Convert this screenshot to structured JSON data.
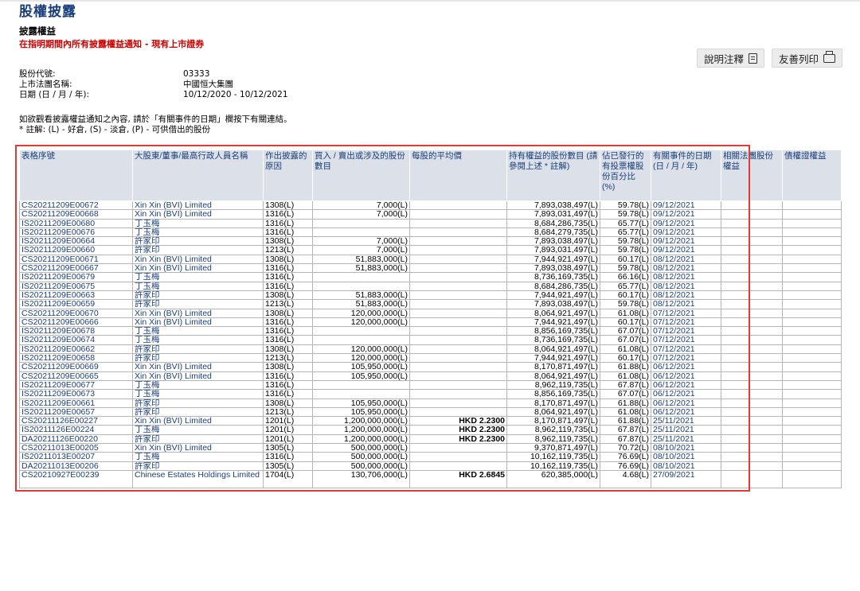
{
  "page_title": "股權披露",
  "section_title": "披露權益",
  "notice": "在指明期間內所有披露權益通知 - 現有上市證券",
  "toolbar": {
    "notes_label": "說明注釋",
    "print_label": "友善列印"
  },
  "meta": [
    {
      "label": "股份代號:",
      "value": "03333"
    },
    {
      "label": "上市法團名稱:",
      "value": "中國恒大集團"
    },
    {
      "label": "日期 (日 / 月 / 年):",
      "value": "10/12/2020 - 10/12/2021"
    }
  ],
  "instructions": [
    "如欲觀看披露權益通知之內容, 請於「有關事件的日期」欄按下有關連結。",
    "* 註解: (L) - 好倉, (S) - 淡倉, (P) - 可供借出的股份"
  ],
  "table": {
    "headers": [
      "表格序號",
      "大股東/董事/最高行政人員名稱",
      "作出披露的原因",
      "買入 / 賣出或涉及的股份數目",
      "每股的平均價",
      "持有權益的股份數目 (請參閱上述 * 註解)",
      "佔已發行的有投票權股份百分比 (%)",
      "有關事件的日期 (日 / 月 / 年)",
      "相關法團股份權益",
      "債權證權益"
    ],
    "rows": [
      [
        "CS20211209E00672",
        "Xin Xin (BVI) Limited",
        "1308(L)",
        "7,000(L)",
        "",
        "7,893,038,497(L)",
        "59.78(L)",
        "09/12/2021"
      ],
      [
        "CS20211209E00668",
        "Xin Xin (BVI) Limited",
        "1316(L)",
        "7,000(L)",
        "",
        "7,893,031,497(L)",
        "59.78(L)",
        "09/12/2021"
      ],
      [
        "IS20211209E00680",
        "丁玉梅",
        "1316(L)",
        "",
        "",
        "8,684,286,735(L)",
        "65.77(L)",
        "09/12/2021"
      ],
      [
        "IS20211209E00676",
        "丁玉梅",
        "1316(L)",
        "",
        "",
        "8,684,279,735(L)",
        "65.77(L)",
        "09/12/2021"
      ],
      [
        "IS20211209E00664",
        "許家印",
        "1308(L)",
        "7,000(L)",
        "",
        "7,893,038,497(L)",
        "59.78(L)",
        "09/12/2021"
      ],
      [
        "IS20211209E00660",
        "許家印",
        "1213(L)",
        "7,000(L)",
        "",
        "7,893,031,497(L)",
        "59.78(L)",
        "09/12/2021"
      ],
      [
        "CS20211209E00671",
        "Xin Xin (BVI) Limited",
        "1308(L)",
        "51,883,000(L)",
        "",
        "7,944,921,497(L)",
        "60.17(L)",
        "08/12/2021"
      ],
      [
        "CS20211209E00667",
        "Xin Xin (BVI) Limited",
        "1316(L)",
        "51,883,000(L)",
        "",
        "7,893,038,497(L)",
        "59.78(L)",
        "08/12/2021"
      ],
      [
        "IS20211209E00679",
        "丁玉梅",
        "1316(L)",
        "",
        "",
        "8,736,169,735(L)",
        "66.16(L)",
        "08/12/2021"
      ],
      [
        "IS20211209E00675",
        "丁玉梅",
        "1316(L)",
        "",
        "",
        "8,684,286,735(L)",
        "65.77(L)",
        "08/12/2021"
      ],
      [
        "IS20211209E00663",
        "許家印",
        "1308(L)",
        "51,883,000(L)",
        "",
        "7,944,921,497(L)",
        "60.17(L)",
        "08/12/2021"
      ],
      [
        "IS20211209E00659",
        "許家印",
        "1213(L)",
        "51,883,000(L)",
        "",
        "7,893,038,497(L)",
        "59.78(L)",
        "08/12/2021"
      ],
      [
        "CS20211209E00670",
        "Xin Xin (BVI) Limited",
        "1308(L)",
        "120,000,000(L)",
        "",
        "8,064,921,497(L)",
        "61.08(L)",
        "07/12/2021"
      ],
      [
        "CS20211209E00666",
        "Xin Xin (BVI) Limited",
        "1316(L)",
        "120,000,000(L)",
        "",
        "7,944,921,497(L)",
        "60.17(L)",
        "07/12/2021"
      ],
      [
        "IS20211209E00678",
        "丁玉梅",
        "1316(L)",
        "",
        "",
        "8,856,169,735(L)",
        "67.07(L)",
        "07/12/2021"
      ],
      [
        "IS20211209E00674",
        "丁玉梅",
        "1316(L)",
        "",
        "",
        "8,736,169,735(L)",
        "67.07(L)",
        "07/12/2021"
      ],
      [
        "IS20211209E00662",
        "許家印",
        "1308(L)",
        "120,000,000(L)",
        "",
        "8,064,921,497(L)",
        "61.08(L)",
        "07/12/2021"
      ],
      [
        "IS20211209E00658",
        "許家印",
        "1213(L)",
        "120,000,000(L)",
        "",
        "7,944,921,497(L)",
        "60.17(L)",
        "07/12/2021"
      ],
      [
        "CS20211209E00669",
        "Xin Xin (BVI) Limited",
        "1308(L)",
        "105,950,000(L)",
        "",
        "8,170,871,497(L)",
        "61.88(L)",
        "06/12/2021"
      ],
      [
        "CS20211209E00665",
        "Xin Xin (BVI) Limited",
        "1316(L)",
        "105,950,000(L)",
        "",
        "8,064,921,497(L)",
        "61.08(L)",
        "06/12/2021"
      ],
      [
        "IS20211209E00677",
        "丁玉梅",
        "1316(L)",
        "",
        "",
        "8,962,119,735(L)",
        "67.87(L)",
        "06/12/2021"
      ],
      [
        "IS20211209E00673",
        "丁玉梅",
        "1316(L)",
        "",
        "",
        "8,856,169,735(L)",
        "67.07(L)",
        "06/12/2021"
      ],
      [
        "IS20211209E00661",
        "許家印",
        "1308(L)",
        "105,950,000(L)",
        "",
        "8,170,871,497(L)",
        "61.88(L)",
        "06/12/2021"
      ],
      [
        "IS20211209E00657",
        "許家印",
        "1213(L)",
        "105,950,000(L)",
        "",
        "8,064,921,497(L)",
        "61.08(L)",
        "06/12/2021"
      ],
      [
        "CS20211126E00227",
        "Xin Xin (BVI) Limited",
        "1201(L)",
        "1,200,000,000(L)",
        "HKD 2.2300",
        "8,170,871,497(L)",
        "61.88(L)",
        "25/11/2021"
      ],
      [
        "IS20211126E00224",
        "丁玉梅",
        "1201(L)",
        "1,200,000,000(L)",
        "HKD 2.2300",
        "8,962,119,735(L)",
        "67.87(L)",
        "25/11/2021"
      ],
      [
        "DA20211126E00220",
        "許家印",
        "1201(L)",
        "1,200,000,000(L)",
        "HKD 2.2300",
        "8,962,119,735(L)",
        "67.87(L)",
        "25/11/2021"
      ],
      [
        "CS20211013E00205",
        "Xin Xin (BVI) Limited",
        "1305(L)",
        "500,000,000(L)",
        "",
        "9,370,871,497(L)",
        "70.72(L)",
        "08/10/2021"
      ],
      [
        "IS20211013E00207",
        "丁玉梅",
        "1316(L)",
        "500,000,000(L)",
        "",
        "10,162,119,735(L)",
        "76.69(L)",
        "08/10/2021"
      ],
      [
        "DA20211013E00206",
        "許家印",
        "1305(L)",
        "500,000,000(L)",
        "",
        "10,162,119,735(L)",
        "76.69(L)",
        "08/10/2021"
      ],
      [
        "CS20210927E00239",
        "Chinese Estates Holdings Limited",
        "1704(L)",
        "130,706,000(L)",
        "HKD 2.6845",
        "620,385,000(L)",
        "4.68(L)",
        "27/09/2021"
      ]
    ]
  },
  "colors": {
    "title": "#1a3f7a",
    "notice": "#cc0000",
    "header_bg": "#dce0e8",
    "highlight": "#e53935"
  },
  "icons": {
    "notes": "document-icon",
    "print": "printer-icon"
  }
}
